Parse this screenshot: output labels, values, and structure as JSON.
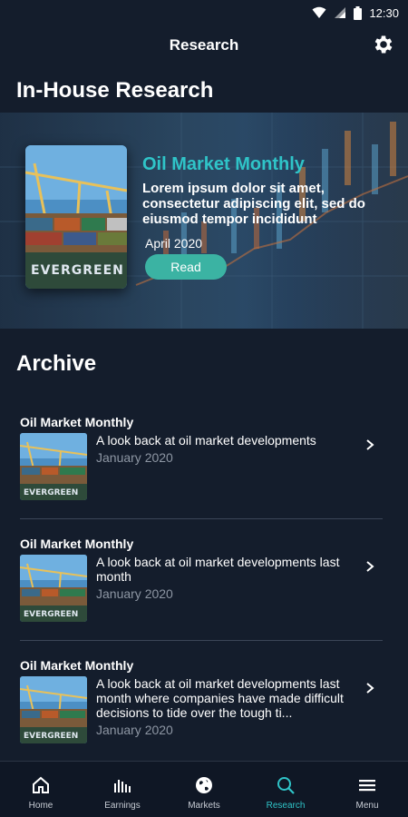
{
  "status_bar": {
    "time": "12:30"
  },
  "app_bar": {
    "title": "Research"
  },
  "inhouse": {
    "heading": "In-House Research",
    "featured": {
      "cover_text": "EVERGREEN",
      "title": "Oil Market Monthly",
      "description": "Lorem ipsum dolor sit amet, consectetur adipiscing elit, sed do eiusmod tempor incididunt",
      "date": "April 2020",
      "read_label": "Read"
    }
  },
  "archive": {
    "heading": "Archive",
    "items": [
      {
        "title": "Oil Market Monthly",
        "description": "A look back at oil market developments",
        "date": "January 2020",
        "thumb_text": "EVERGREEN"
      },
      {
        "title": "Oil Market Monthly",
        "description": "A look back at oil market developments last month",
        "date": "January 2020",
        "thumb_text": "EVERGREEN"
      },
      {
        "title": "Oil Market Monthly",
        "description": "A look back at oil market developments last month where companies have made difficult decisions to tide over the tough ti...",
        "date": "January 2020",
        "thumb_text": "EVERGREEN"
      }
    ]
  },
  "nav": {
    "items": [
      {
        "label": "Home",
        "icon": "home-icon"
      },
      {
        "label": "Earnings",
        "icon": "bar-chart-icon"
      },
      {
        "label": "Markets",
        "icon": "globe-icon"
      },
      {
        "label": "Research",
        "icon": "search-icon"
      },
      {
        "label": "Menu",
        "icon": "hamburger-menu-icon"
      }
    ],
    "active": "Research"
  },
  "colors": {
    "background": "#141d2c",
    "accent": "#2fc4c8",
    "button": "#3bb3a3",
    "muted_text": "#8d96a3"
  }
}
